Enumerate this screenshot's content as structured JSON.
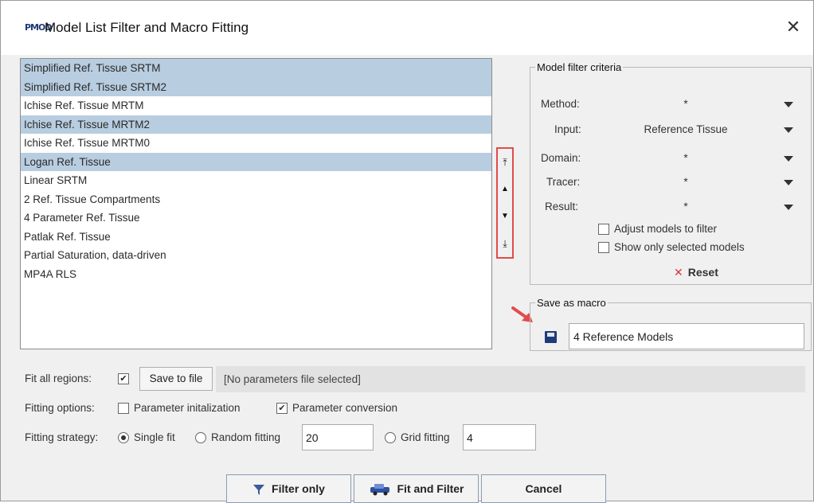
{
  "window": {
    "title": "Model List Filter and Macro Fitting",
    "app_icon": "PMOD",
    "close_glyph": "✕"
  },
  "models": [
    {
      "label": "Simplified Ref. Tissue SRTM",
      "selected": true
    },
    {
      "label": "Simplified Ref. Tissue SRTM2",
      "selected": true
    },
    {
      "label": "Ichise Ref. Tissue MRTM",
      "selected": false
    },
    {
      "label": "Ichise Ref. Tissue MRTM2",
      "selected": true
    },
    {
      "label": "Ichise Ref. Tissue MRTM0",
      "selected": false
    },
    {
      "label": "Logan Ref. Tissue",
      "selected": true
    },
    {
      "label": "Linear SRTM",
      "selected": false
    },
    {
      "label": "2 Ref. Tissue Compartments",
      "selected": false
    },
    {
      "label": "4 Parameter Ref. Tissue",
      "selected": false
    },
    {
      "label": "Patlak Ref. Tissue",
      "selected": false
    },
    {
      "label": "Partial Saturation, data-driven",
      "selected": false
    },
    {
      "label": "MP4A RLS",
      "selected": false
    }
  ],
  "order_buttons": {
    "top": "⤒",
    "up": "▲",
    "down": "▼",
    "bottom": "⤓"
  },
  "filter": {
    "legend": "Model filter criteria",
    "rows": [
      {
        "label": "Method:",
        "value": "*"
      },
      {
        "label": "Input:",
        "value": "Reference Tissue"
      },
      {
        "label": "Domain:",
        "value": "*"
      },
      {
        "label": "Tracer:",
        "value": "*"
      },
      {
        "label": "Result:",
        "value": "*"
      }
    ],
    "adjust_label": "Adjust models to filter",
    "adjust_checked": false,
    "show_selected_label": "Show only selected models",
    "show_selected_checked": false,
    "reset_label": "Reset",
    "reset_glyph": "✕"
  },
  "macro": {
    "legend": "Save as macro",
    "name_value": "4 Reference Models"
  },
  "fit_regions": {
    "label": "Fit all regions:",
    "checked": true,
    "check_glyph": "✔",
    "save_button": "Save to file",
    "file_status": "[No parameters file selected]"
  },
  "fitting_options": {
    "label": "Fitting options:",
    "param_init_label": "Parameter initalization",
    "param_init_checked": false,
    "param_conv_label": "Parameter conversion",
    "param_conv_checked": true,
    "check_glyph": "✔"
  },
  "fitting_strategy": {
    "label": "Fitting strategy:",
    "single_label": "Single fit",
    "random_label": "Random fitting",
    "random_value": "20",
    "grid_label": "Grid fitting",
    "grid_value": "4",
    "selected": "single"
  },
  "buttons": {
    "filter_only": "Filter only",
    "fit_and_filter": "Fit and Filter",
    "cancel": "Cancel"
  },
  "colors": {
    "selection": "#b8cde0",
    "highlight_box": "#e34b4b",
    "save_icon": "#1e3a78"
  }
}
